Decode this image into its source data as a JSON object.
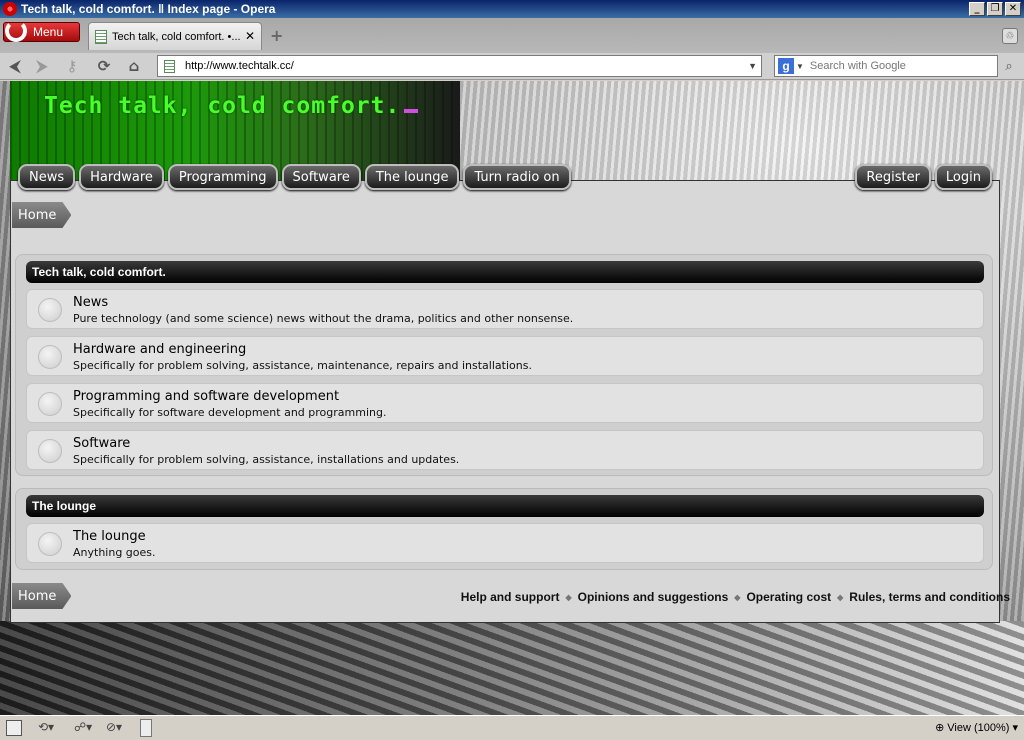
{
  "window": {
    "title": "Tech talk, cold comfort. ‖ Index page - Opera",
    "min_glyph": "_",
    "max_glyph": "❐",
    "close_glyph": "✕"
  },
  "browser": {
    "menu_label": "Menu",
    "tab_title": "Tech talk, cold comfort. •...",
    "tab_close": "✕",
    "new_tab": "+",
    "url": "http://www.techtalk.cc/",
    "search_placeholder": "Search with Google",
    "search_engine": "g",
    "icons": {
      "back": "arrow-left-icon",
      "forward": "arrow-right-icon",
      "key": "key-icon",
      "reload": "reload-icon",
      "home": "home-icon",
      "trash": "trash-icon"
    },
    "glyphs": {
      "back": "⮜",
      "forward": "⮞",
      "key": "⚷",
      "reload": "⟳",
      "home": "⌂",
      "search": "⌕",
      "dropdown": "▼",
      "trash": "♲"
    }
  },
  "site": {
    "title": "Tech talk, cold comfort.",
    "nav": [
      "News",
      "Hardware",
      "Programming",
      "Software",
      "The lounge",
      "Turn radio on"
    ],
    "user_nav": [
      "Register",
      "Login"
    ],
    "breadcrumb": "Home",
    "categories": [
      {
        "heading": "Tech talk, cold comfort.",
        "forums": [
          {
            "title": "News",
            "desc": "Pure technology (and some science) news without the drama, politics and other nonsense."
          },
          {
            "title": "Hardware and engineering",
            "desc": "Specifically for problem solving, assistance, maintenance, repairs and installations."
          },
          {
            "title": "Programming and software development",
            "desc": "Specifically for software development and programming."
          },
          {
            "title": "Software",
            "desc": "Specifically for problem solving, assistance, installations and updates."
          }
        ]
      },
      {
        "heading": "The lounge",
        "forums": [
          {
            "title": "The lounge",
            "desc": "Anything goes."
          }
        ]
      }
    ],
    "footer_breadcrumb": "Home",
    "footer_links": [
      "Help and support",
      "Opinions and suggestions",
      "Operating cost",
      "Rules, terms and conditions"
    ],
    "footer_sep": "◆",
    "accent_green": "#49ff2a",
    "cursor_color": "#d04fe0"
  },
  "statusbar": {
    "zoom": "View (100%)"
  }
}
